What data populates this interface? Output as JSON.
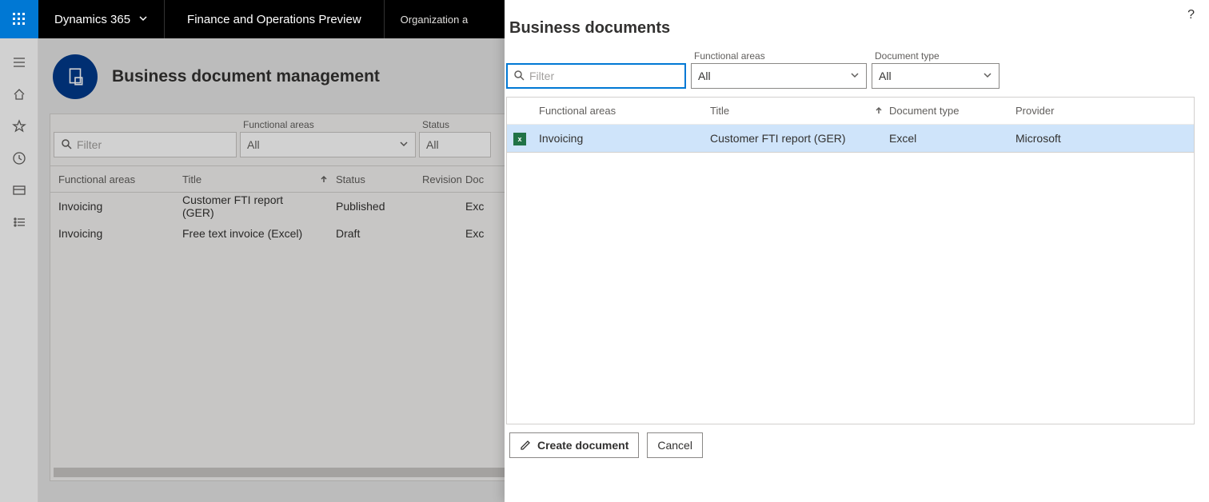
{
  "topbar": {
    "app_name": "Dynamics 365",
    "env_name": "Finance and Operations Preview",
    "breadcrumb": "Organization a"
  },
  "page": {
    "title": "Business document management"
  },
  "bg_filters": {
    "filter_placeholder": "Filter",
    "functional_areas_label": "Functional areas",
    "functional_areas_value": "All",
    "status_label": "Status",
    "status_value": "All"
  },
  "bg_table": {
    "headers": {
      "functional_areas": "Functional areas",
      "title": "Title",
      "status": "Status",
      "revision": "Revision",
      "document": "Doc"
    },
    "rows": [
      {
        "fa": "Invoicing",
        "title": "Customer FTI report (GER)",
        "status": "Published",
        "rev": "",
        "doc": "Exc"
      },
      {
        "fa": "Invoicing",
        "title": "Free text invoice (Excel)",
        "status": "Draft",
        "rev": "",
        "doc": "Exc"
      }
    ]
  },
  "panel": {
    "title": "Business documents",
    "filter_placeholder": "Filter",
    "functional_areas_label": "Functional areas",
    "functional_areas_value": "All",
    "document_type_label": "Document type",
    "document_type_value": "All",
    "table": {
      "headers": {
        "functional_areas": "Functional areas",
        "title": "Title",
        "document_type": "Document type",
        "provider": "Provider"
      },
      "rows": [
        {
          "fa": "Invoicing",
          "title": "Customer FTI report (GER)",
          "doc_type": "Excel",
          "provider": "Microsoft"
        }
      ]
    },
    "buttons": {
      "create": "Create document",
      "cancel": "Cancel"
    }
  }
}
